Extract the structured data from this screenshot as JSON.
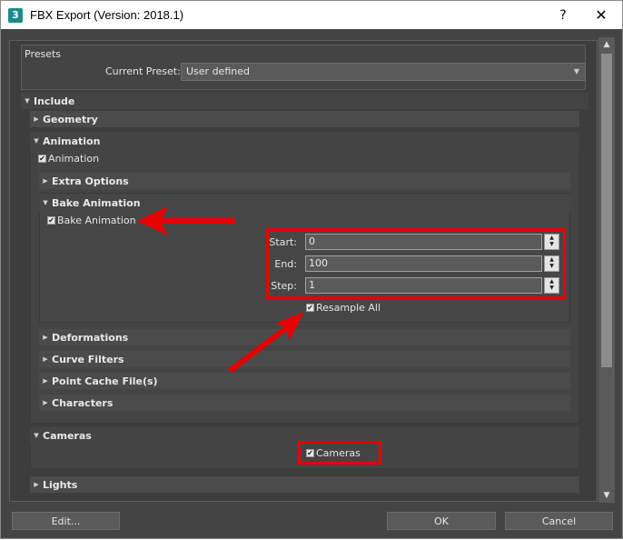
{
  "window": {
    "app_icon": "3",
    "title": "FBX Export (Version: 2018.1)",
    "help_glyph": "?",
    "close_glyph": "✕"
  },
  "presets": {
    "title": "Presets",
    "current_label": "Current Preset:",
    "current_value": "User defined"
  },
  "include": {
    "title": "Include",
    "geometry": "Geometry",
    "animation": {
      "title": "Animation",
      "checkbox": "Animation",
      "extra_options": "Extra Options",
      "bake": {
        "title": "Bake Animation",
        "checkbox": "Bake Animation",
        "start_label": "Start:",
        "start_value": "0",
        "end_label": "End:",
        "end_value": "100",
        "step_label": "Step:",
        "step_value": "1",
        "resample": "Resample All"
      },
      "deformations": "Deformations",
      "curve_filters": "Curve Filters",
      "point_cache": "Point Cache File(s)",
      "characters": "Characters"
    },
    "cameras": {
      "title": "Cameras",
      "checkbox": "Cameras"
    },
    "lights": "Lights"
  },
  "buttons": {
    "edit": "Edit...",
    "ok": "OK",
    "cancel": "Cancel"
  },
  "annotation_color": "#e60000"
}
